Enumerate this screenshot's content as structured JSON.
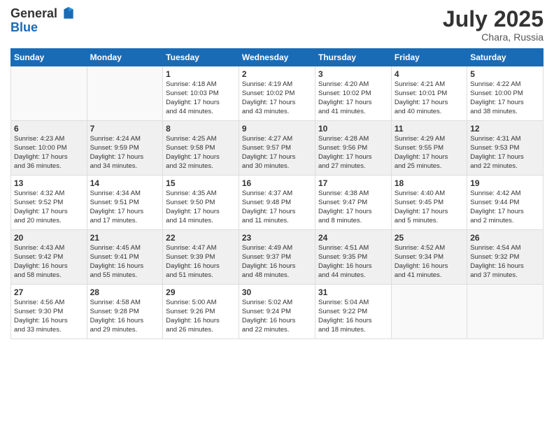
{
  "logo": {
    "general": "General",
    "blue": "Blue"
  },
  "title": "July 2025",
  "location": "Chara, Russia",
  "days_header": [
    "Sunday",
    "Monday",
    "Tuesday",
    "Wednesday",
    "Thursday",
    "Friday",
    "Saturday"
  ],
  "weeks": [
    {
      "days": [
        {
          "num": "",
          "info": ""
        },
        {
          "num": "",
          "info": ""
        },
        {
          "num": "1",
          "info": "Sunrise: 4:18 AM\nSunset: 10:03 PM\nDaylight: 17 hours\nand 44 minutes."
        },
        {
          "num": "2",
          "info": "Sunrise: 4:19 AM\nSunset: 10:02 PM\nDaylight: 17 hours\nand 43 minutes."
        },
        {
          "num": "3",
          "info": "Sunrise: 4:20 AM\nSunset: 10:02 PM\nDaylight: 17 hours\nand 41 minutes."
        },
        {
          "num": "4",
          "info": "Sunrise: 4:21 AM\nSunset: 10:01 PM\nDaylight: 17 hours\nand 40 minutes."
        },
        {
          "num": "5",
          "info": "Sunrise: 4:22 AM\nSunset: 10:00 PM\nDaylight: 17 hours\nand 38 minutes."
        }
      ]
    },
    {
      "days": [
        {
          "num": "6",
          "info": "Sunrise: 4:23 AM\nSunset: 10:00 PM\nDaylight: 17 hours\nand 36 minutes."
        },
        {
          "num": "7",
          "info": "Sunrise: 4:24 AM\nSunset: 9:59 PM\nDaylight: 17 hours\nand 34 minutes."
        },
        {
          "num": "8",
          "info": "Sunrise: 4:25 AM\nSunset: 9:58 PM\nDaylight: 17 hours\nand 32 minutes."
        },
        {
          "num": "9",
          "info": "Sunrise: 4:27 AM\nSunset: 9:57 PM\nDaylight: 17 hours\nand 30 minutes."
        },
        {
          "num": "10",
          "info": "Sunrise: 4:28 AM\nSunset: 9:56 PM\nDaylight: 17 hours\nand 27 minutes."
        },
        {
          "num": "11",
          "info": "Sunrise: 4:29 AM\nSunset: 9:55 PM\nDaylight: 17 hours\nand 25 minutes."
        },
        {
          "num": "12",
          "info": "Sunrise: 4:31 AM\nSunset: 9:53 PM\nDaylight: 17 hours\nand 22 minutes."
        }
      ]
    },
    {
      "days": [
        {
          "num": "13",
          "info": "Sunrise: 4:32 AM\nSunset: 9:52 PM\nDaylight: 17 hours\nand 20 minutes."
        },
        {
          "num": "14",
          "info": "Sunrise: 4:34 AM\nSunset: 9:51 PM\nDaylight: 17 hours\nand 17 minutes."
        },
        {
          "num": "15",
          "info": "Sunrise: 4:35 AM\nSunset: 9:50 PM\nDaylight: 17 hours\nand 14 minutes."
        },
        {
          "num": "16",
          "info": "Sunrise: 4:37 AM\nSunset: 9:48 PM\nDaylight: 17 hours\nand 11 minutes."
        },
        {
          "num": "17",
          "info": "Sunrise: 4:38 AM\nSunset: 9:47 PM\nDaylight: 17 hours\nand 8 minutes."
        },
        {
          "num": "18",
          "info": "Sunrise: 4:40 AM\nSunset: 9:45 PM\nDaylight: 17 hours\nand 5 minutes."
        },
        {
          "num": "19",
          "info": "Sunrise: 4:42 AM\nSunset: 9:44 PM\nDaylight: 17 hours\nand 2 minutes."
        }
      ]
    },
    {
      "days": [
        {
          "num": "20",
          "info": "Sunrise: 4:43 AM\nSunset: 9:42 PM\nDaylight: 16 hours\nand 58 minutes."
        },
        {
          "num": "21",
          "info": "Sunrise: 4:45 AM\nSunset: 9:41 PM\nDaylight: 16 hours\nand 55 minutes."
        },
        {
          "num": "22",
          "info": "Sunrise: 4:47 AM\nSunset: 9:39 PM\nDaylight: 16 hours\nand 51 minutes."
        },
        {
          "num": "23",
          "info": "Sunrise: 4:49 AM\nSunset: 9:37 PM\nDaylight: 16 hours\nand 48 minutes."
        },
        {
          "num": "24",
          "info": "Sunrise: 4:51 AM\nSunset: 9:35 PM\nDaylight: 16 hours\nand 44 minutes."
        },
        {
          "num": "25",
          "info": "Sunrise: 4:52 AM\nSunset: 9:34 PM\nDaylight: 16 hours\nand 41 minutes."
        },
        {
          "num": "26",
          "info": "Sunrise: 4:54 AM\nSunset: 9:32 PM\nDaylight: 16 hours\nand 37 minutes."
        }
      ]
    },
    {
      "days": [
        {
          "num": "27",
          "info": "Sunrise: 4:56 AM\nSunset: 9:30 PM\nDaylight: 16 hours\nand 33 minutes."
        },
        {
          "num": "28",
          "info": "Sunrise: 4:58 AM\nSunset: 9:28 PM\nDaylight: 16 hours\nand 29 minutes."
        },
        {
          "num": "29",
          "info": "Sunrise: 5:00 AM\nSunset: 9:26 PM\nDaylight: 16 hours\nand 26 minutes."
        },
        {
          "num": "30",
          "info": "Sunrise: 5:02 AM\nSunset: 9:24 PM\nDaylight: 16 hours\nand 22 minutes."
        },
        {
          "num": "31",
          "info": "Sunrise: 5:04 AM\nSunset: 9:22 PM\nDaylight: 16 hours\nand 18 minutes."
        },
        {
          "num": "",
          "info": ""
        },
        {
          "num": "",
          "info": ""
        }
      ]
    }
  ]
}
